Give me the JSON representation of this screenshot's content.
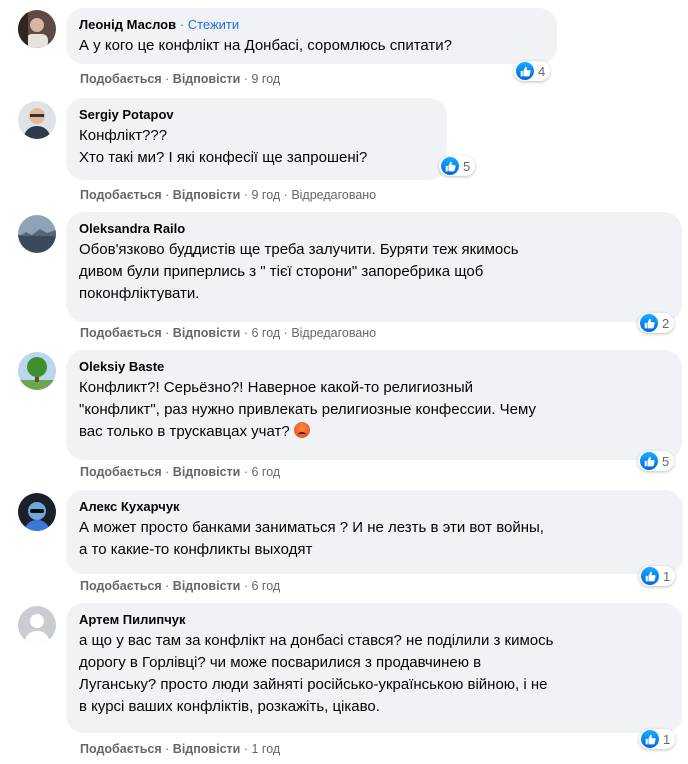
{
  "labels": {
    "like": "Подобається",
    "reply": "Відповісти",
    "sep": "·",
    "edited": "Відредаговано",
    "follow": "Стежити"
  },
  "comments": [
    {
      "author": "Леонід Маслов",
      "text": "А у кого це конфлікт на Донбасі, соромлюсь спитати?",
      "time": "9 год",
      "likes": "4"
    },
    {
      "author": "Sergiy Potapov",
      "text": "Конфлікт???\nХто такі ми? І які конфесії ще запрошені?",
      "time": "9 год",
      "likes": "5"
    },
    {
      "author": "Oleksandra Railo",
      "text": "Обов'язково буддистів ще треба залучити. Буряти теж якимось\nдивом були приперлись з \" тієї сторони\" запоребрика щоб\nпоконфліктувати.",
      "time": "6 год",
      "likes": "2"
    },
    {
      "author": "Oleksiy Baste",
      "text": "Конфликт?! Серьёзно?! Наверное какой-то религиозный\n\"конфликт\", раз нужно привлекать религиозные конфессии. Чему\nвас только в трускавцах учат?",
      "time": "6 год",
      "likes": "5",
      "emoji": "angry-face"
    },
    {
      "author": "Алекс Кухарчук",
      "text": "А может просто банками заниматься ? И не лезть в эти вот войны,\nа то какие-то конфликты выходят",
      "time": "6 год",
      "likes": "1"
    },
    {
      "author": "Артем Пилипчук",
      "text": "а що у вас там за конфлікт на донбасі стався? не поділили з кимось\nдорогу в Горлівці? чи може посварилися з продавчинею в\nЛуганську? просто люди зайняті російсько-українською війною, і не\nв курсі ваших конфліктів, розкажіть, цікаво.",
      "time": "1 год",
      "likes": "1"
    }
  ]
}
